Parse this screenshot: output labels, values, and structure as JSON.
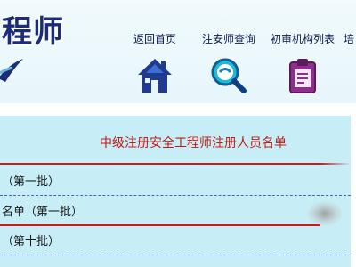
{
  "header": {
    "logo_text": "程师",
    "nav": [
      {
        "label": "返回首页",
        "icon": "home-icon"
      },
      {
        "label": "注安师查询",
        "icon": "magnifier-icon"
      },
      {
        "label": "初审机构列表",
        "icon": "clipboard-icon"
      },
      {
        "label": "培",
        "icon": ""
      }
    ]
  },
  "content": {
    "title": "中级注册安全工程师注册人员名单",
    "rows": [
      {
        "text": "（第一批）"
      },
      {
        "text": "名单（第一批）"
      },
      {
        "text": "（第十批）"
      }
    ]
  },
  "colors": {
    "title_red": "#c41c14",
    "nav_text": "#0d1a4d",
    "panel_bg": "#c7eef7",
    "logo_blue": "#1b2d78"
  }
}
